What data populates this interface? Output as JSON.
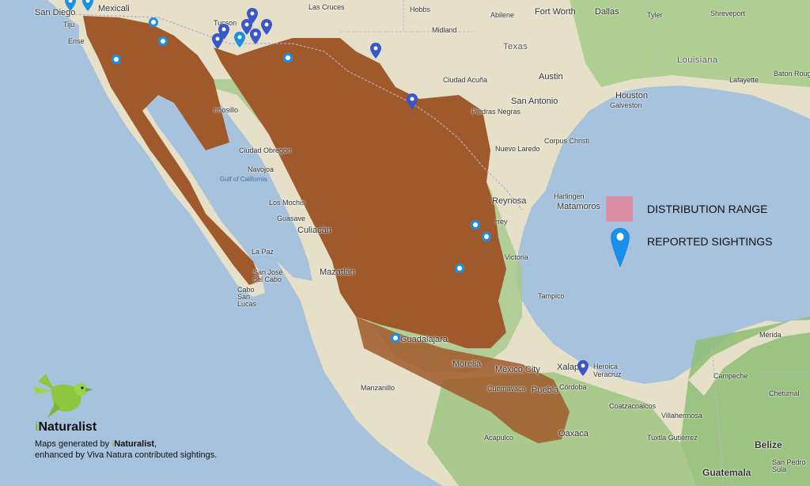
{
  "map": {
    "labels": {
      "san_diego": "San Diego",
      "mexicali": "Mexicali",
      "tijuana": "Tiju",
      "ensenada": "Ense",
      "las_cruces": "Las Cruces",
      "hobbs": "Hobbs",
      "abilene": "Abilene",
      "fort_worth": "Fort Worth",
      "dallas": "Dallas",
      "tyler": "Tyler",
      "shreveport": "Shreveport",
      "tucson": "Tucson",
      "midland": "Midland",
      "texas": "Texas",
      "louisiana": "Louisiana",
      "austin": "Austin",
      "houston": "Houston",
      "lafayette": "Lafayette",
      "baton_rouge": "Baton Roug",
      "galveston": "Galveston",
      "san_antonio": "San Antonio",
      "hermosillo": "rmosillo",
      "ciudad_acuna": "Ciudad Acuña",
      "piedras_negras": "Piedras Negras",
      "corpus_christi": "Corpus Christi",
      "nuevo_laredo": "Nuevo Laredo",
      "ciudad_obregon": "Ciudad Obregón",
      "navojoa": "Navojoa",
      "gulf_of_california": "Gulf of California",
      "los_mochis": "Los Mochis",
      "guasave": "Guasave",
      "harlingen": "Harlingen",
      "reynosa": "Reynosa",
      "matamoros": "Matamoros",
      "culiacan": "Culiacán",
      "la_paz": "La Paz",
      "san_jose_del_cabo": "San José del Cabo",
      "cabo_san_lucas": "Cabo San Lucas",
      "mazatlan": "Mazatlán",
      "victoria": "Victoria",
      "tampico": "Tampico",
      "guadalajara": "Guadalajara",
      "morelia": "Morelia",
      "mexico_city": "Mexico City",
      "puebla": "Puebla",
      "xalapa": "Xalapa",
      "heroica_veracruz": "Heroica Veracruz",
      "cordoba": "Córdoba",
      "oaxaca": "Oaxaca",
      "acapulco": "Acapulco",
      "cuernavaca": "Cuernavaca",
      "villahermosa": "Villahermosa",
      "tuxtla": "Tuxtla Gutiérrez",
      "belize": "Belize",
      "guatemala": "Guatemala",
      "campeche": "Campeche",
      "chetumal": "Chetumal",
      "san_pedro_sula": "San Pedro Sula",
      "merida": "Mérida",
      "coatzacoalcos": "Coatzacoalcos",
      "manzanillo": "Manzanillo",
      "monterrey": "rrey"
    }
  },
  "legend": {
    "distribution_label": "DISTRIBUTION RANGE",
    "sightings_label": "REPORTED SIGHTINGS",
    "swatch_color": "#d98ea4",
    "marker_color": "#1a8fe6"
  },
  "branding": {
    "brand_i": "i",
    "brand_rest": "Naturalist",
    "credit_prefix": "Maps generated by ",
    "credit_brand_i": "i",
    "credit_brand_rest": "Naturalist",
    "credit_suffix": ",",
    "credit_line2": "enhanced by Viva Natura contributed sightings."
  },
  "colors": {
    "water": "#a6c2dd",
    "land": "#e8e2cf",
    "vegetation": "#9cc48a",
    "range": "#a0592a",
    "logo_green": "#8dc63f"
  }
}
